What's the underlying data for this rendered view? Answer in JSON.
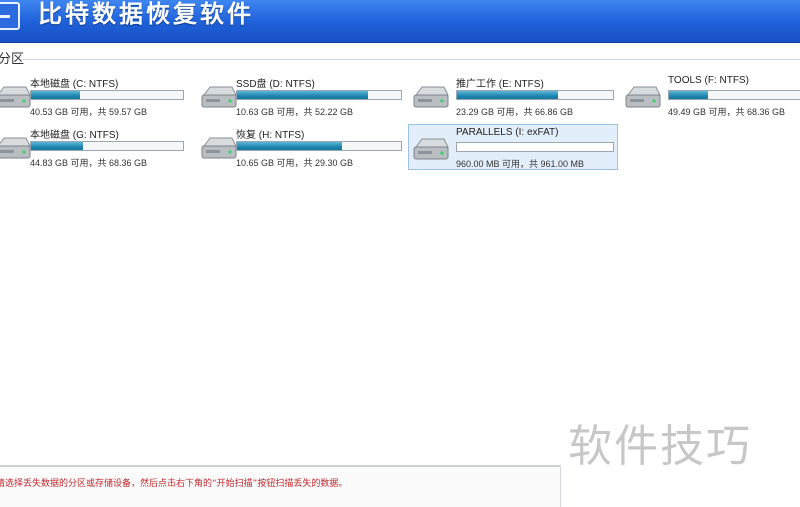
{
  "app": {
    "title": "比特数据恢复软件"
  },
  "section": {
    "label": "分区"
  },
  "drives": [
    {
      "name": "本地磁盘 (C: NTFS)",
      "info": "40.53 GB 可用，共 59.57 GB",
      "free_fraction": 0.68
    },
    {
      "name": "SSD盘 (D: NTFS)",
      "info": "10.63 GB 可用，共 52.22 GB",
      "free_fraction": 0.2
    },
    {
      "name": "推广工作 (E: NTFS)",
      "info": "23.29 GB 可用，共 66.86 GB",
      "free_fraction": 0.35
    },
    {
      "name": "TOOLS (F: NTFS)",
      "info": "49.49 GB 可用，共 68.36 GB",
      "free_fraction": 0.72
    },
    {
      "name": "本地磁盘 (G: NTFS)",
      "info": "44.83 GB 可用，共 68.36 GB",
      "free_fraction": 0.66
    },
    {
      "name": "恢复 (H: NTFS)",
      "info": "10.65 GB 可用，共 29.30 GB",
      "free_fraction": 0.36
    },
    {
      "name": "PARALLELS (I: exFAT)",
      "info": "960.00 MB 可用，共 961.00 MB",
      "free_fraction": 0.999
    }
  ],
  "status": {
    "message": "请选择丢失数据的分区或存储设备，然后点击右下角的“开始扫描”按钮扫描丢失的数据。"
  },
  "watermark": {
    "text": "软件技巧"
  },
  "colors": {
    "title_bar": "#1e5fd8",
    "usage_fill": "#1f87b0",
    "status_text": "#c0282d",
    "selection": "#e3eefb"
  }
}
